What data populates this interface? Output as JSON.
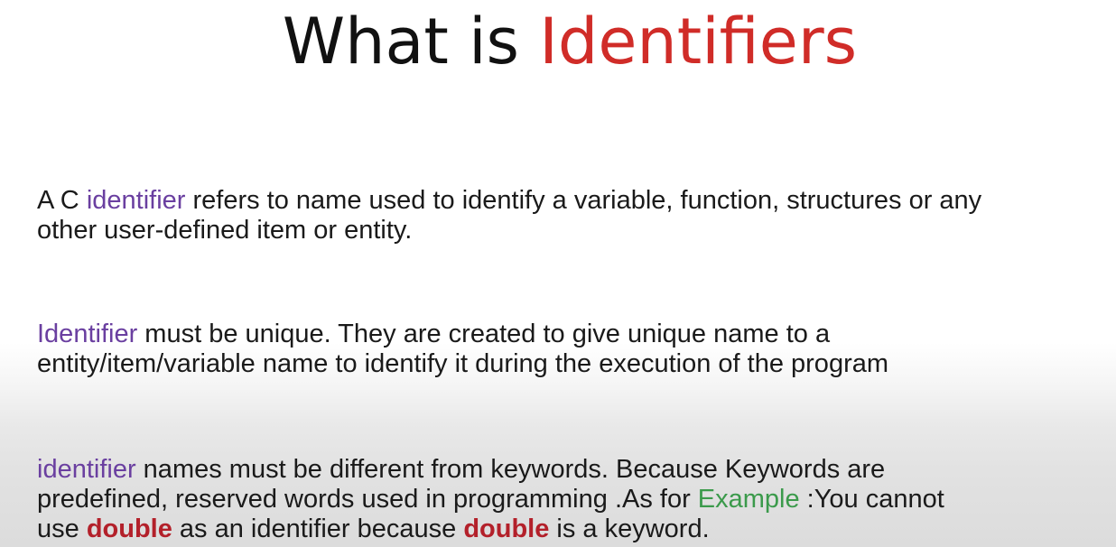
{
  "title": {
    "prefix": "What is ",
    "accent": "Identifiers"
  },
  "paragraph1": {
    "line1_start": "A C ",
    "line1_term": "identifier",
    "line1_rest": " refers to name used to identify a variable, function, structures  or any",
    "line2": "other user-defined item or entity."
  },
  "paragraph2": {
    "line1_term": "Identifier",
    "line1_rest": " must be unique. They are created to give unique name to a",
    "line2": "entity/item/variable name to identify it during the execution of the program"
  },
  "paragraph3": {
    "line1_term": "identifier",
    "line1_rest": " names must be different from keywords. Because Keywords are",
    "line2_start": "predefined, reserved words used in programming .As for ",
    "line2_term": "Example",
    "line2_rest": " :You cannot",
    "line3_start": "use ",
    "line3_kw1": "double",
    "line3_mid": " as an identifier because ",
    "line3_kw2": "double",
    "line3_end": " is a keyword."
  },
  "colors": {
    "title_accent": "#d02c28",
    "term_purple": "#6a3fa0",
    "example_green": "#3b9a4b",
    "keyword_red": "#b3202a"
  }
}
